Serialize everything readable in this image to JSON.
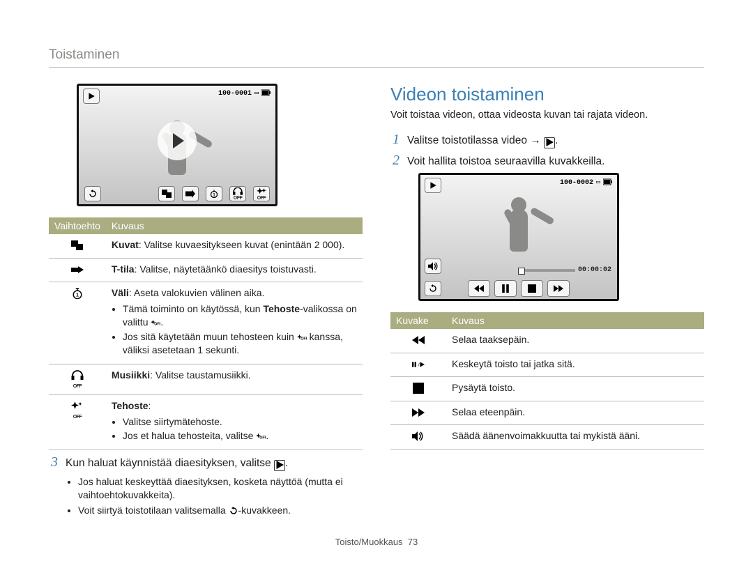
{
  "running_header": "Toistaminen",
  "slideshow_screen": {
    "file_counter": "100-0001",
    "topbar_icons": [
      "play-box-icon",
      "battery-icon"
    ],
    "bottom_icons": [
      "back-icon",
      "one-pair-icon",
      "single-icon",
      "timer-1-icon",
      "music-off-icon",
      "sparkle-off-icon"
    ]
  },
  "options_table": {
    "header_option": "Vaihtoehto",
    "header_desc": "Kuvaus",
    "rows": [
      {
        "icon": "one-pair-icon",
        "title": "Kuvat",
        "after_title": ": Valitse kuvaesitykseen kuvat (enintään 2 000)."
      },
      {
        "icon": "arrow-right-bold-icon",
        "title": "T-tila",
        "after_title": ": Valitse, näytetäänkö diaesitys toistuvasti."
      },
      {
        "icon": "timer-1-icon",
        "title": "Väli",
        "after_title": ": Aseta valokuvien välinen aika.",
        "bullets": [
          "Tämä toiminto on käytössä, kun <b>Tehoste</b>-valikossa on valittu <span class=\"off-sparkle\"></span>.",
          "Jos sitä käytetään muun tehosteen kuin <span class=\"off-sparkle\"></span> kanssa, väliksi asetetaan 1 sekunti."
        ]
      },
      {
        "icon": "music-off-icon",
        "title": "Musiikki",
        "after_title": ": Valitse taustamusiikki."
      },
      {
        "icon": "sparkle-off-icon",
        "title": "Tehoste",
        "after_title": ":",
        "bullets": [
          "Valitse siirtymätehoste.",
          "Jos et halua tehosteita, valitse <span class=\"off-sparkle\"></span>."
        ]
      }
    ]
  },
  "step3": {
    "num": "3",
    "text": "Kun haluat käynnistää diaesityksen, valitse ",
    "after_icon": "."
  },
  "step3_bullets": [
    "Jos haluat keskeyttää diaesityksen, kosketa näyttöä (mutta ei vaihtoehtokuvakkeita).",
    "Voit siirtyä toistotilaan valitsemalla ↶-kuvakkeen."
  ],
  "video_section": {
    "heading": "Videon toistaminen",
    "intro": "Voit toistaa videon, ottaa videosta kuvan tai rajata videon.",
    "step1_num": "1",
    "step1_text": "Valitse toistotilassa video → ",
    "step1_after": ".",
    "step2_num": "2",
    "step2_text": "Voit hallita toistoa seuraavilla kuvakkeilla."
  },
  "video_screen": {
    "file_counter": "100-0002",
    "time": "00:00:02",
    "transport": [
      "rewind-icon",
      "pause-icon",
      "stop-icon",
      "forward-icon"
    ]
  },
  "video_table": {
    "header_icon": "Kuvake",
    "header_desc": "Kuvaus",
    "rows": [
      {
        "icon": "rewind-icon",
        "desc": "Selaa taaksepäin."
      },
      {
        "icon": "pause-play-icon",
        "desc": "Keskeytä toisto tai jatka sitä."
      },
      {
        "icon": "stop-icon",
        "desc": "Pysäytä toisto."
      },
      {
        "icon": "forward-icon",
        "desc": "Selaa eteenpäin."
      },
      {
        "icon": "speaker-icon",
        "desc": "Säädä äänenvoimakkuutta tai mykistä ääni."
      }
    ]
  },
  "page_footer_prefix": "Toisto/Muokkaus",
  "page_number": 73
}
